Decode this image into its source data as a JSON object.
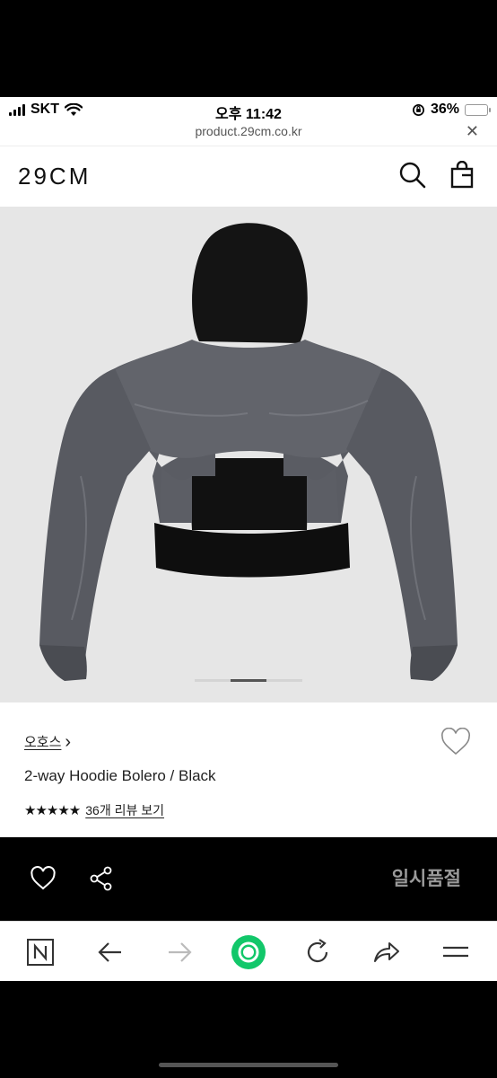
{
  "status_bar": {
    "carrier": "SKT",
    "time": "오후 11:42",
    "battery": "36%",
    "battery_level": 0.36
  },
  "browser": {
    "url": "product.29cm.co.kr",
    "close": "✕"
  },
  "header": {
    "logo": "29CM"
  },
  "product": {
    "brand": "오호스",
    "brand_chevron": "›",
    "title": "2-way Hoodie Bolero / Black",
    "stars": "★★★★★",
    "review_link": "36개 리뷰 보기",
    "image_index": 2,
    "image_count": 3
  },
  "action_bar": {
    "sold_out": "일시품절"
  },
  "colors": {
    "accent_green": "#12c76a",
    "sold_out_text": "#9a9a9a",
    "battery_fill": "#f5c400"
  }
}
